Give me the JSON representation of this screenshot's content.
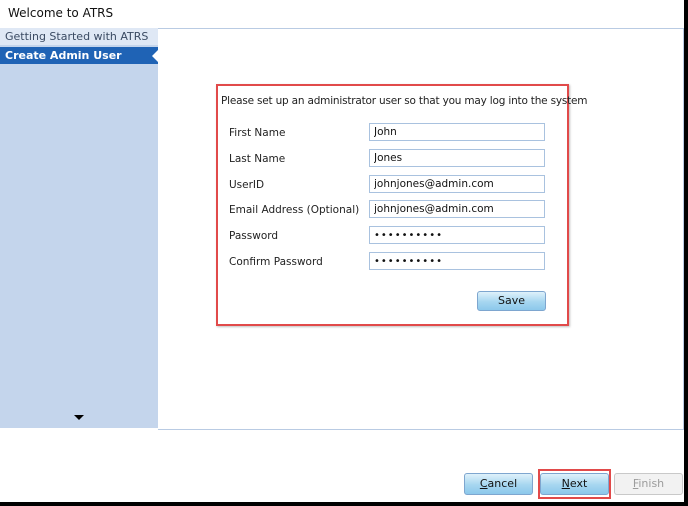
{
  "window": {
    "title": "Welcome to ATRS"
  },
  "sidebar": {
    "items": [
      {
        "label": "Getting Started with ATRS",
        "active": false
      },
      {
        "label": "Create Admin User",
        "active": true
      }
    ],
    "scroll_icon": "triangle-down-icon"
  },
  "form": {
    "intro": "Please set up an administrator user so that you may log into the system",
    "fields": [
      {
        "label": "First Name",
        "value": "John"
      },
      {
        "label": "Last Name",
        "value": "Jones"
      },
      {
        "label": "UserID",
        "value": "johnjones@admin.com"
      },
      {
        "label": "Email Address (Optional)",
        "value": "johnjones@admin.com"
      },
      {
        "label": "Password",
        "value": "••••••••••"
      },
      {
        "label": "Confirm Password",
        "value": "••••••••••"
      }
    ],
    "save_label": "Save"
  },
  "footer": {
    "cancel_prefix": "C",
    "cancel_rest": "ancel",
    "next_prefix": "N",
    "next_rest": "ext",
    "finish_prefix": "F",
    "finish_rest": "inish"
  },
  "colors": {
    "accent": "#1f63b5",
    "highlight": "#e14a4a",
    "sidebar_bg": "#c4d5ec"
  }
}
